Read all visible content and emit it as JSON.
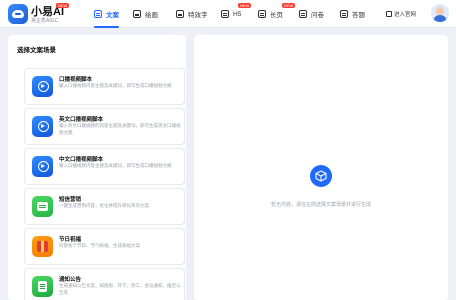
{
  "header": {
    "brand": "小易AI",
    "brand_badge": "NEW",
    "brand_sub": "易企秀AIGC",
    "nav": [
      {
        "label": "文案",
        "icon": "document-icon",
        "active": true
      },
      {
        "label": "绘画",
        "icon": "image-icon"
      },
      {
        "label": "特效字",
        "icon": "image-icon"
      },
      {
        "label": "H5",
        "icon": "document-icon",
        "badge": "NEW"
      },
      {
        "label": "长页",
        "icon": "document-icon",
        "badge": "NEW"
      },
      {
        "label": "问卷",
        "icon": "document-icon"
      },
      {
        "label": "答题",
        "icon": "document-icon"
      }
    ],
    "portal": "进入官网"
  },
  "left": {
    "title": "选择文案场景",
    "cards": [
      {
        "title": "口播视频脚本",
        "desc": "输入口播视频内容主题及关键词，即可生成口播视频文稿",
        "icon": "video-icon"
      },
      {
        "title": "英文口播视频脚本",
        "desc": "输入英文口播视频的内容主题及关键词，即可生成英文口播视频文稿",
        "icon": "video-icon"
      },
      {
        "title": "中文口播视频脚本",
        "desc": "输入口播视频内容主题及关键词，即可生成口播视频文稿",
        "icon": "video-icon"
      },
      {
        "title": "短信营销",
        "desc": "一键生成营销内容，优化并提升转化率的文案",
        "icon": "sms-icon"
      },
      {
        "title": "节日祝福",
        "desc": "同意各个节日、节气祝福，生成祝福文案",
        "icon": "gift-icon"
      },
      {
        "title": "通知公告",
        "desc": "生成通知公告文案，如放假、开学、停工、会议通知、推迟公告等",
        "icon": "notice-icon"
      }
    ]
  },
  "right": {
    "empty_text": "暂无内容，请在左侧选择文案场景并进行生成",
    "icon": "cube-icon"
  },
  "colors": {
    "accent": "#1f6bff",
    "badge": "#ff3b30"
  }
}
